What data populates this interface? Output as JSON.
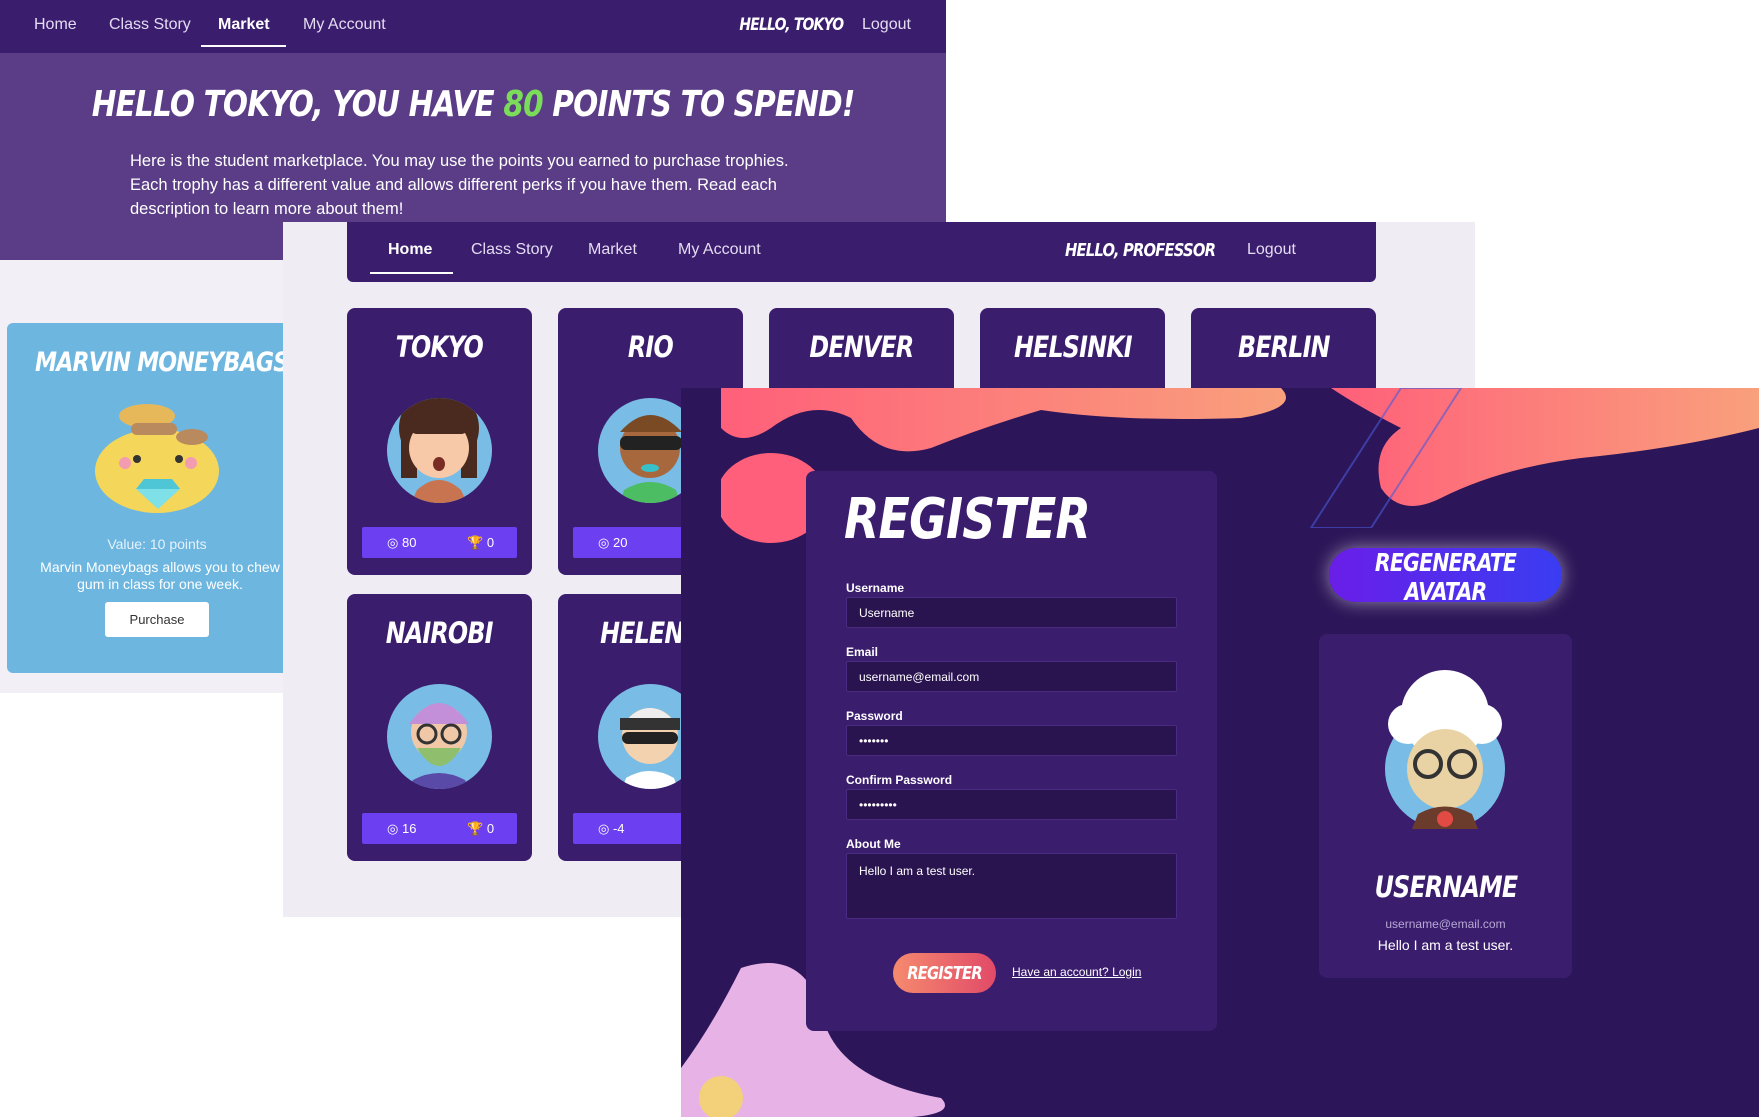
{
  "market": {
    "nav": {
      "items": [
        "Home",
        "Class Story",
        "Market",
        "My Account"
      ],
      "greeting": "Hello, Tokyo",
      "logout": "Logout"
    },
    "hero": {
      "title_pre": "Hello Tokyo, you have ",
      "points": "80",
      "title_post": " points to spend!",
      "description": "Here is the student marketplace. You may use the points you earned to purchase trophies. Each trophy has a different value and allows different perks if you have them. Read each description to learn more about them!"
    },
    "trophy": {
      "name": "Marvin Moneybags",
      "value": "Value: 10 points",
      "description": "Marvin Moneybags allows you to chew gum in class for one week.",
      "button": "Purchase"
    }
  },
  "home": {
    "nav": {
      "items": [
        "Home",
        "Class Story",
        "Market",
        "My Account"
      ],
      "greeting": "Hello, Professor",
      "logout": "Logout"
    },
    "students": [
      {
        "name": "Tokyo",
        "points": "80",
        "trophies": "0"
      },
      {
        "name": "Rio",
        "points": "20",
        "trophies": ""
      },
      {
        "name": "Denver",
        "points": "",
        "trophies": ""
      },
      {
        "name": "Helsinki",
        "points": "",
        "trophies": ""
      },
      {
        "name": "Berlin",
        "points": "",
        "trophies": ""
      },
      {
        "name": "Nairobi",
        "points": "16",
        "trophies": "0"
      },
      {
        "name": "Helena",
        "points": "-4",
        "trophies": ""
      }
    ]
  },
  "register": {
    "title": "Register",
    "fields": {
      "username_label": "Username",
      "username_placeholder": "Username",
      "email_label": "Email",
      "email_value": "username@email.com",
      "password_label": "Password",
      "password_value": "•••••••",
      "confirm_label": "Confirm Password",
      "confirm_value": "•••••••••",
      "about_label": "About Me",
      "about_value": "Hello I am a test user."
    },
    "submit": "Register",
    "login_link": "Have an account? Login",
    "regenerate": "Regenerate Avatar",
    "preview": {
      "name": "Username",
      "email": "username@email.com",
      "about": "Hello I am a test user."
    }
  },
  "colors": {
    "nav": "#3b1d6e",
    "accent": "#6c3ff0",
    "points_green": "#7bdc5a",
    "trophy_card": "#6db6e0"
  }
}
